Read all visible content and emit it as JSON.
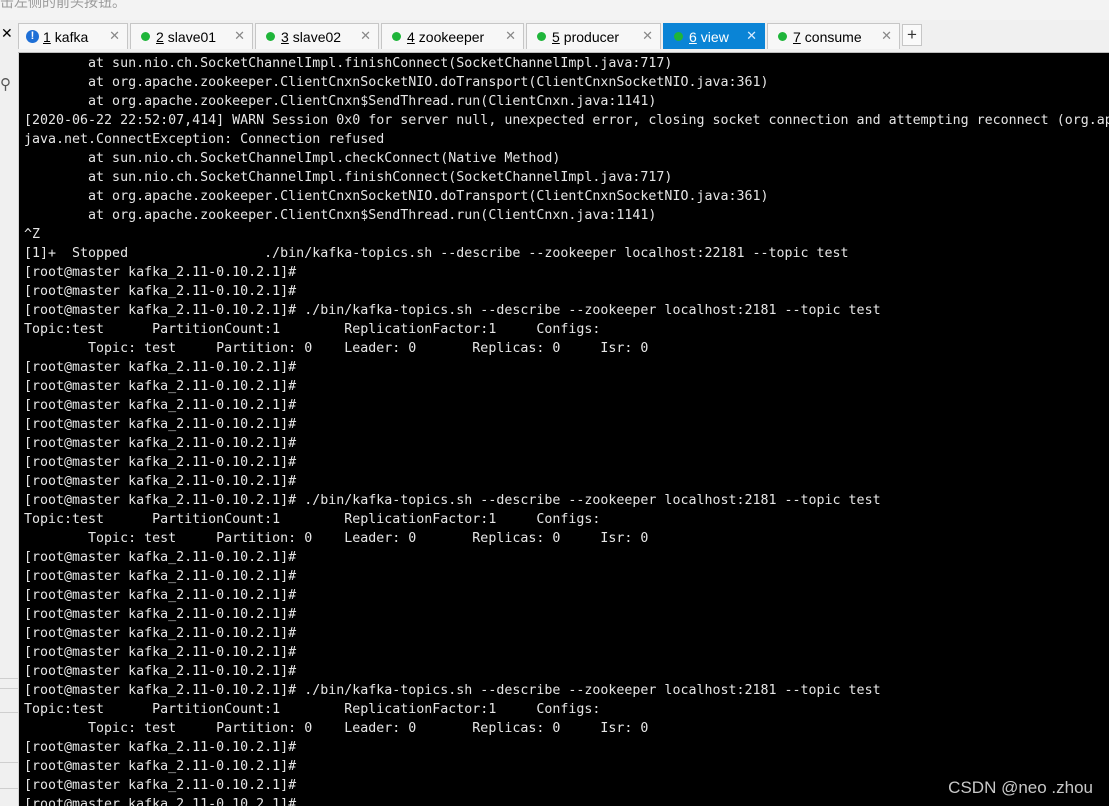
{
  "top_hint": "击左侧的前头按钮。",
  "tabs": [
    {
      "num": "1",
      "label": "kafka",
      "status": "warning"
    },
    {
      "num": "2",
      "label": "slave01",
      "status": "connected"
    },
    {
      "num": "3",
      "label": "slave02",
      "status": "connected"
    },
    {
      "num": "4",
      "label": "zookeeper",
      "status": "connected"
    },
    {
      "num": "5",
      "label": "producer",
      "status": "connected"
    },
    {
      "num": "6",
      "label": "view",
      "status": "connected",
      "active": true
    },
    {
      "num": "7",
      "label": "consume",
      "status": "connected"
    }
  ],
  "add_tab_label": "+",
  "terminal_lines": [
    "        at sun.nio.ch.SocketChannelImpl.finishConnect(SocketChannelImpl.java:717)",
    "        at org.apache.zookeeper.ClientCnxnSocketNIO.doTransport(ClientCnxnSocketNIO.java:361)",
    "        at org.apache.zookeeper.ClientCnxn$SendThread.run(ClientCnxn.java:1141)",
    "[2020-06-22 22:52:07,414] WARN Session 0x0 for server null, unexpected error, closing socket connection and attempting reconnect (org.ap",
    "java.net.ConnectException: Connection refused",
    "        at sun.nio.ch.SocketChannelImpl.checkConnect(Native Method)",
    "        at sun.nio.ch.SocketChannelImpl.finishConnect(SocketChannelImpl.java:717)",
    "        at org.apache.zookeeper.ClientCnxnSocketNIO.doTransport(ClientCnxnSocketNIO.java:361)",
    "        at org.apache.zookeeper.ClientCnxn$SendThread.run(ClientCnxn.java:1141)",
    "^Z",
    "[1]+  Stopped                 ./bin/kafka-topics.sh --describe --zookeeper localhost:22181 --topic test",
    "[root@master kafka_2.11-0.10.2.1]#",
    "[root@master kafka_2.11-0.10.2.1]#",
    "[root@master kafka_2.11-0.10.2.1]# ./bin/kafka-topics.sh --describe --zookeeper localhost:2181 --topic test",
    "Topic:test      PartitionCount:1        ReplicationFactor:1     Configs:",
    "        Topic: test     Partition: 0    Leader: 0       Replicas: 0     Isr: 0",
    "[root@master kafka_2.11-0.10.2.1]#",
    "[root@master kafka_2.11-0.10.2.1]#",
    "[root@master kafka_2.11-0.10.2.1]#",
    "[root@master kafka_2.11-0.10.2.1]#",
    "[root@master kafka_2.11-0.10.2.1]#",
    "[root@master kafka_2.11-0.10.2.1]#",
    "[root@master kafka_2.11-0.10.2.1]#",
    "[root@master kafka_2.11-0.10.2.1]# ./bin/kafka-topics.sh --describe --zookeeper localhost:2181 --topic test",
    "Topic:test      PartitionCount:1        ReplicationFactor:1     Configs:",
    "        Topic: test     Partition: 0    Leader: 0       Replicas: 0     Isr: 0",
    "[root@master kafka_2.11-0.10.2.1]#",
    "[root@master kafka_2.11-0.10.2.1]#",
    "[root@master kafka_2.11-0.10.2.1]#",
    "[root@master kafka_2.11-0.10.2.1]#",
    "[root@master kafka_2.11-0.10.2.1]#",
    "[root@master kafka_2.11-0.10.2.1]#",
    "[root@master kafka_2.11-0.10.2.1]#",
    "[root@master kafka_2.11-0.10.2.1]# ./bin/kafka-topics.sh --describe --zookeeper localhost:2181 --topic test",
    "Topic:test      PartitionCount:1        ReplicationFactor:1     Configs:",
    "        Topic: test     Partition: 0    Leader: 0       Replicas: 0     Isr: 0",
    "[root@master kafka_2.11-0.10.2.1]#",
    "[root@master kafka_2.11-0.10.2.1]#",
    "[root@master kafka_2.11-0.10.2.1]#",
    "[root@master kafka_2.11-0.10.2.1]#"
  ],
  "watermark": "CSDN @neo .zhou",
  "colors": {
    "terminal_bg": "#000000",
    "terminal_fg": "#e6e6e6",
    "active_tab": "#0a84d6",
    "status_dot": "#1fb53a"
  },
  "icons": {
    "close_pane": "close-icon",
    "search": "search-icon",
    "tab_close": "close-icon",
    "add_tab": "plus-icon"
  }
}
